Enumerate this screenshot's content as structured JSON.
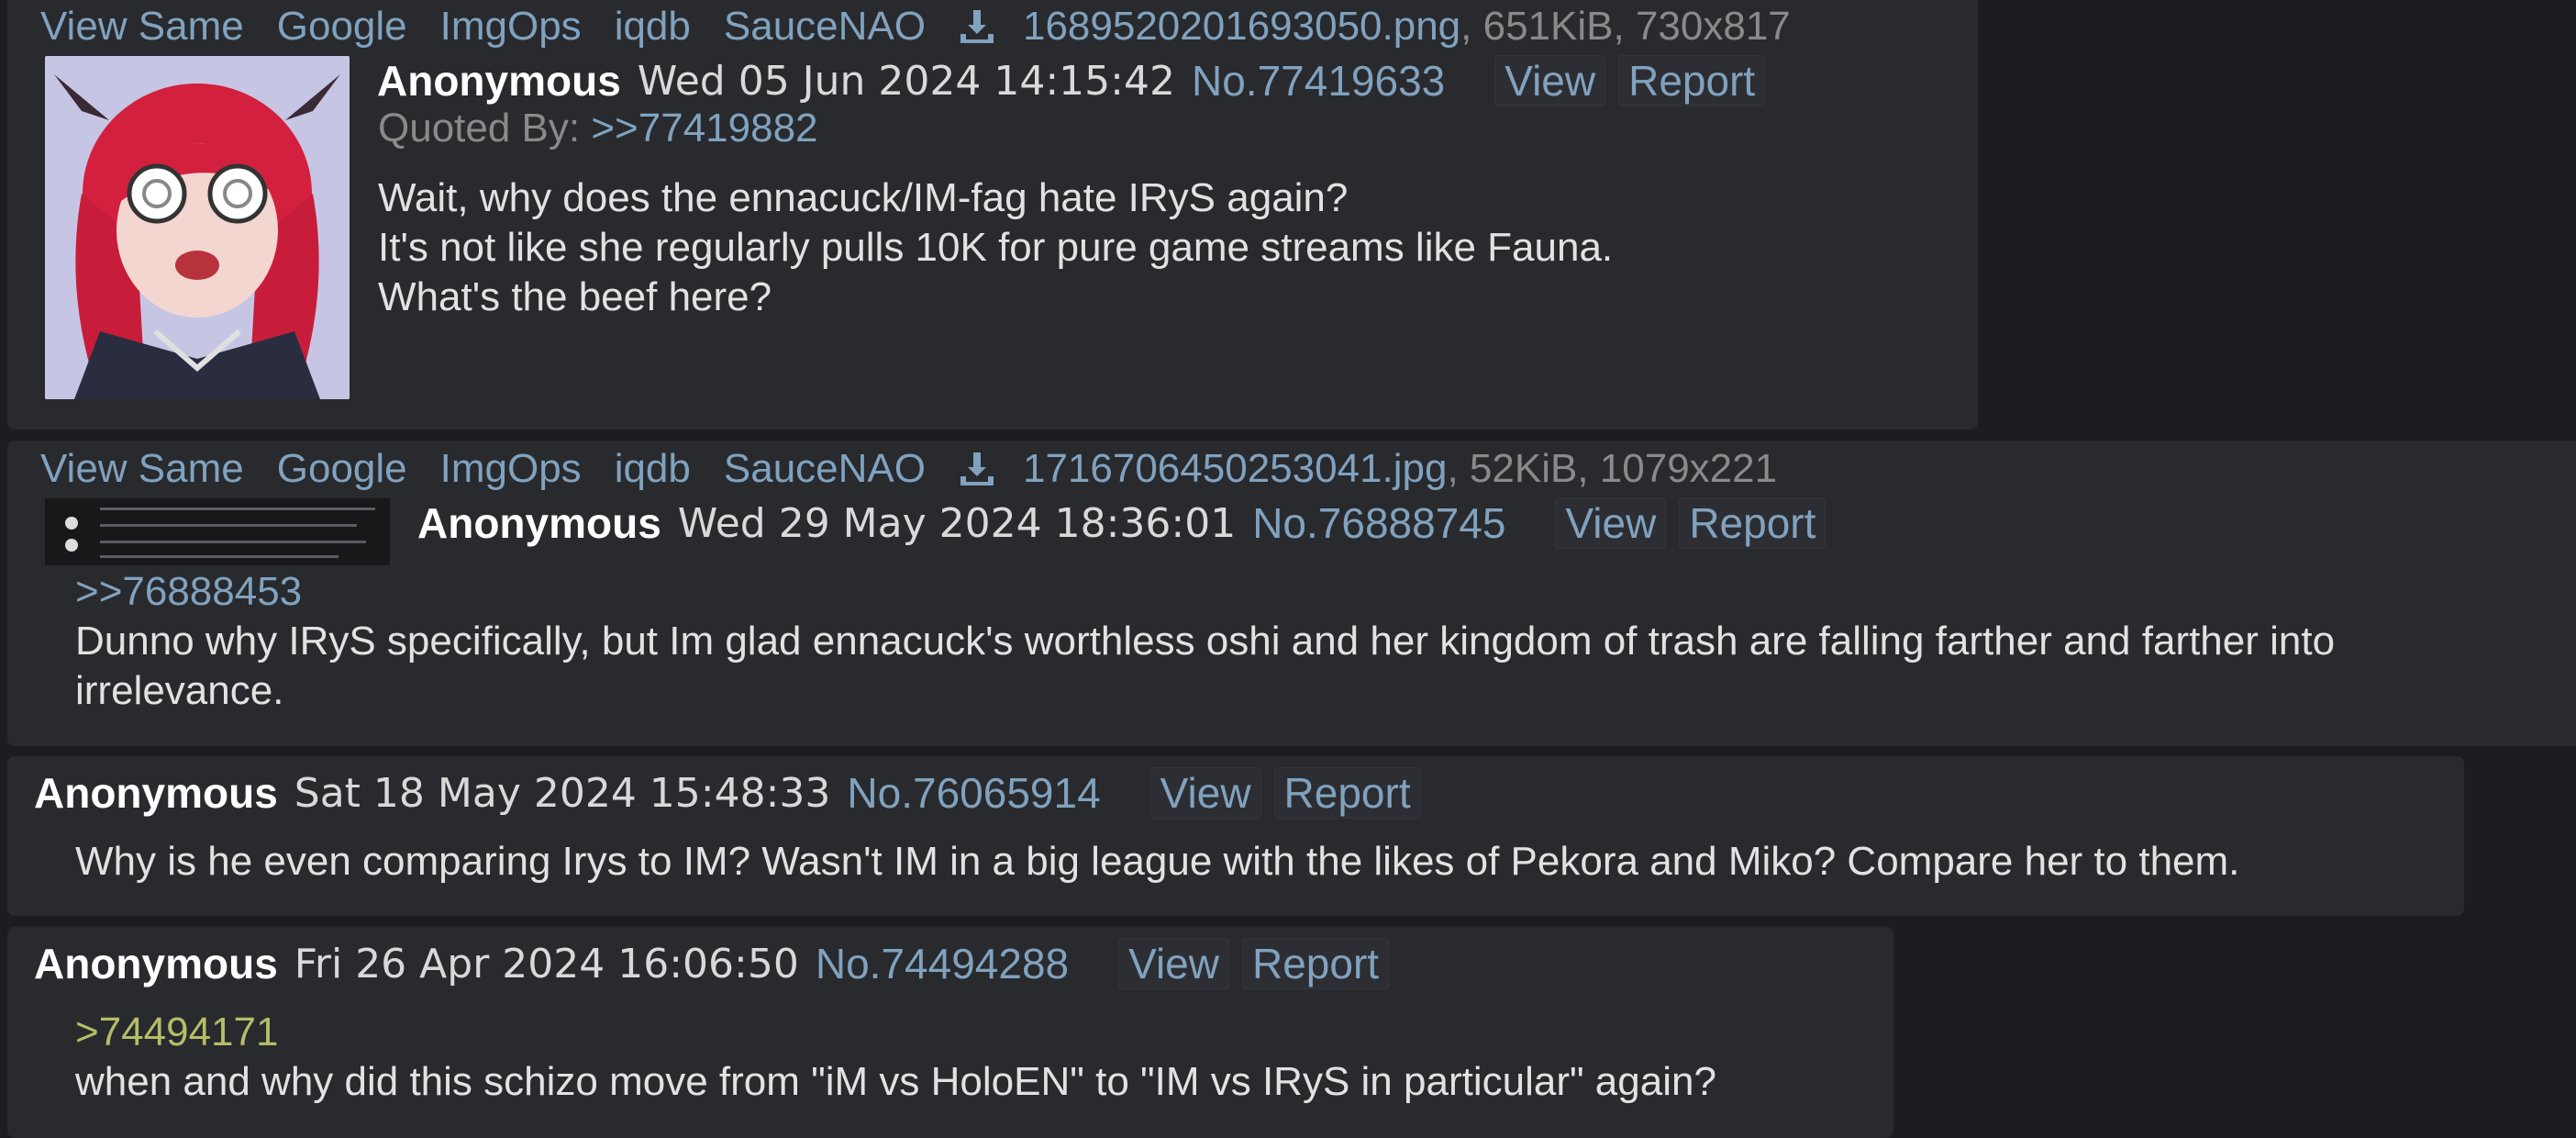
{
  "filebar_links": [
    "View Same",
    "Google",
    "ImgOps",
    "iqdb",
    "SauceNAO"
  ],
  "icons": {
    "download": "download-icon"
  },
  "post1": {
    "file_name": "1689520201693050.png",
    "file_meta": ", 651KiB, 730x817",
    "name": "Anonymous",
    "date": "Wed 05 Jun 2024 14:15:42",
    "number": "No.77419633",
    "view": "View",
    "report": "Report",
    "quoted_by_label": "Quoted By: ",
    "quoted_by_link": ">>77419882",
    "lines": [
      "Wait, why does the ennacuck/IM-fag hate IRyS again?",
      "It's not like she regularly pulls 10K for pure game streams like Fauna.",
      "What's the beef here?"
    ]
  },
  "post2": {
    "file_name": "1716706450253041.jpg",
    "file_meta": ", 52KiB, 1079x221",
    "name": "Anonymous",
    "date": "Wed 29 May 2024 18:36:01",
    "number": "No.76888745",
    "view": "View",
    "report": "Report",
    "quote_link": ">>76888453",
    "text": "Dunno why IRyS specifically, but Im glad ennacuck's worthless oshi and her kingdom of trash are falling farther and farther into irrelevance."
  },
  "post3": {
    "name": "Anonymous",
    "date": "Sat 18 May 2024 15:48:33",
    "number": "No.76065914",
    "view": "View",
    "report": "Report",
    "text": "Why is he even comparing Irys to IM? Wasn't IM in a big league with the likes of Pekora and Miko? Compare her to them."
  },
  "post4": {
    "name": "Anonymous",
    "date": "Fri 26 Apr 2024 16:06:50",
    "number": "No.74494288",
    "view": "View",
    "report": "Report",
    "greentext": ">74494171",
    "text": "when and why did this schizo move from \"iM vs HoloEN\" to \"IM vs IRyS in particular\" again?"
  }
}
